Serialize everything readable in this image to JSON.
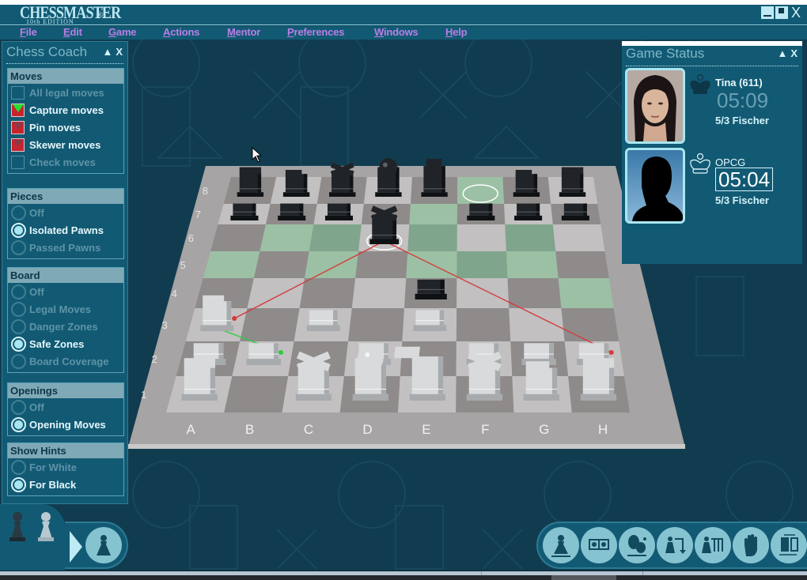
{
  "app": {
    "logo_main": "CHESSMASTER",
    "logo_sub": "10th EDITION",
    "logo_reg": "®",
    "window_controls": [
      "minimize-icon",
      "maximize-icon",
      "close-icon"
    ],
    "close_glyph": "X"
  },
  "menu": {
    "items": [
      {
        "label": "File",
        "accel": "F"
      },
      {
        "label": "Edit",
        "accel": "E"
      },
      {
        "label": "Game",
        "accel": "G"
      },
      {
        "label": "Actions",
        "accel": "A"
      },
      {
        "label": "Mentor",
        "accel": "M"
      },
      {
        "label": "Preferences",
        "accel": "P"
      },
      {
        "label": "Windows",
        "accel": "W"
      },
      {
        "label": "Help",
        "accel": "H"
      }
    ],
    "color": "#b97ee6"
  },
  "coach": {
    "title": "Chess Coach",
    "collapse_glyph": "▲",
    "close_glyph": "X",
    "groups": [
      {
        "heading": "Moves",
        "type": "checkbox",
        "options": [
          {
            "label": "All legal moves",
            "checked": false,
            "marker": "none"
          },
          {
            "label": "Capture moves",
            "checked": true,
            "marker": "green"
          },
          {
            "label": "Pin moves",
            "checked": true,
            "marker": "red"
          },
          {
            "label": "Skewer moves",
            "checked": true,
            "marker": "red"
          },
          {
            "label": "Check moves",
            "checked": false,
            "marker": "none"
          }
        ]
      },
      {
        "heading": "Pieces",
        "type": "radio",
        "options": [
          {
            "label": "Off",
            "checked": false
          },
          {
            "label": "Isolated Pawns",
            "checked": true
          },
          {
            "label": "Passed Pawns",
            "checked": false
          }
        ]
      },
      {
        "heading": "Board",
        "type": "radio",
        "options": [
          {
            "label": "Off",
            "checked": false
          },
          {
            "label": "Legal Moves",
            "checked": false
          },
          {
            "label": "Danger Zones",
            "checked": false
          },
          {
            "label": "Safe Zones",
            "checked": true
          },
          {
            "label": "Board Coverage",
            "checked": false
          }
        ]
      },
      {
        "heading": "Openings",
        "type": "radio",
        "options": [
          {
            "label": "Off",
            "checked": false
          },
          {
            "label": "Opening Moves",
            "checked": true
          }
        ]
      },
      {
        "heading": "Show Hints",
        "type": "radio",
        "options": [
          {
            "label": "For White",
            "checked": false
          },
          {
            "label": "For Black",
            "checked": true
          }
        ]
      }
    ]
  },
  "game_status": {
    "title": "Game Status",
    "collapse_glyph": "▲",
    "close_glyph": "X",
    "players": [
      {
        "name": "Tina (611)",
        "clock": "05:09",
        "time_control": "5/3 Fischer",
        "side": "black",
        "active": false
      },
      {
        "name": "OPCG",
        "clock": "05:04",
        "time_control": "5/3 Fischer",
        "side": "white",
        "active": true
      }
    ]
  },
  "board": {
    "files": [
      "A",
      "B",
      "C",
      "D",
      "E",
      "F",
      "G",
      "H"
    ],
    "ranks": [
      "1",
      "2",
      "3",
      "4",
      "5",
      "6",
      "7",
      "8"
    ],
    "safe_zone_squares": [
      "e7",
      "a5",
      "c5",
      "f5",
      "b6",
      "c6",
      "e6",
      "g6",
      "e5",
      "g5",
      "h4",
      "f8",
      "e7"
    ],
    "highlight_rings": [
      "d6",
      "f8"
    ],
    "pieces": [
      {
        "sq": "a8",
        "color": "black",
        "type": "rook"
      },
      {
        "sq": "b8",
        "color": "black",
        "type": "knight"
      },
      {
        "sq": "c8",
        "color": "black",
        "type": "bishop"
      },
      {
        "sq": "d8",
        "color": "black",
        "type": "queen"
      },
      {
        "sq": "e8",
        "color": "black",
        "type": "king"
      },
      {
        "sq": "g8",
        "color": "black",
        "type": "knight"
      },
      {
        "sq": "h8",
        "color": "black",
        "type": "rook"
      },
      {
        "sq": "a7",
        "color": "black",
        "type": "pawn"
      },
      {
        "sq": "b7",
        "color": "black",
        "type": "pawn"
      },
      {
        "sq": "c7",
        "color": "black",
        "type": "pawn"
      },
      {
        "sq": "d6",
        "color": "black",
        "type": "bishop"
      },
      {
        "sq": "f7",
        "color": "black",
        "type": "pawn"
      },
      {
        "sq": "g7",
        "color": "black",
        "type": "pawn"
      },
      {
        "sq": "h7",
        "color": "black",
        "type": "pawn"
      },
      {
        "sq": "e4",
        "color": "black",
        "type": "pawn"
      },
      {
        "sq": "a3",
        "color": "white",
        "type": "knight"
      },
      {
        "sq": "c3",
        "color": "white",
        "type": "pawn"
      },
      {
        "sq": "e3",
        "color": "white",
        "type": "pawn"
      },
      {
        "sq": "a2",
        "color": "white",
        "type": "pawn"
      },
      {
        "sq": "b2",
        "color": "white",
        "type": "pawn"
      },
      {
        "sq": "d2",
        "color": "white",
        "type": "pawn"
      },
      {
        "sq": "f2",
        "color": "white",
        "type": "pawn"
      },
      {
        "sq": "g2",
        "color": "white",
        "type": "pawn"
      },
      {
        "sq": "h2",
        "color": "white",
        "type": "pawn"
      },
      {
        "sq": "a1",
        "color": "white",
        "type": "rook"
      },
      {
        "sq": "c1",
        "color": "white",
        "type": "bishop"
      },
      {
        "sq": "d1",
        "color": "white",
        "type": "queen"
      },
      {
        "sq": "e1",
        "color": "white",
        "type": "king"
      },
      {
        "sq": "f1",
        "color": "white",
        "type": "bishop"
      },
      {
        "sq": "g1",
        "color": "white",
        "type": "knight"
      },
      {
        "sq": "h1",
        "color": "white",
        "type": "rook"
      }
    ],
    "arrows": [
      {
        "from": "d6",
        "to": "a3",
        "color": "#d43a3a"
      },
      {
        "from": "d6",
        "to": "h2",
        "color": "#d43a3a"
      },
      {
        "from": "a3",
        "to": "b2",
        "color": "#2ecc40"
      }
    ]
  },
  "bottom_left": {
    "pawn_icons": [
      "black-pawn-icon",
      "white-pawn-icon"
    ],
    "play_button": "play-arrow-icon",
    "mode_button": "pawn-icon"
  },
  "toolbar": {
    "buttons": [
      {
        "name": "new-game",
        "icon": "pawn-icon"
      },
      {
        "name": "players",
        "icon": "kings-icon"
      },
      {
        "name": "mentor",
        "icon": "mentor-icon"
      },
      {
        "name": "take-back",
        "icon": "takeback-icon"
      },
      {
        "name": "take-back-all",
        "icon": "takeback-all-icon"
      },
      {
        "name": "stop",
        "icon": "hand-icon"
      },
      {
        "name": "flip-board",
        "icon": "flip-board-icon"
      }
    ]
  }
}
